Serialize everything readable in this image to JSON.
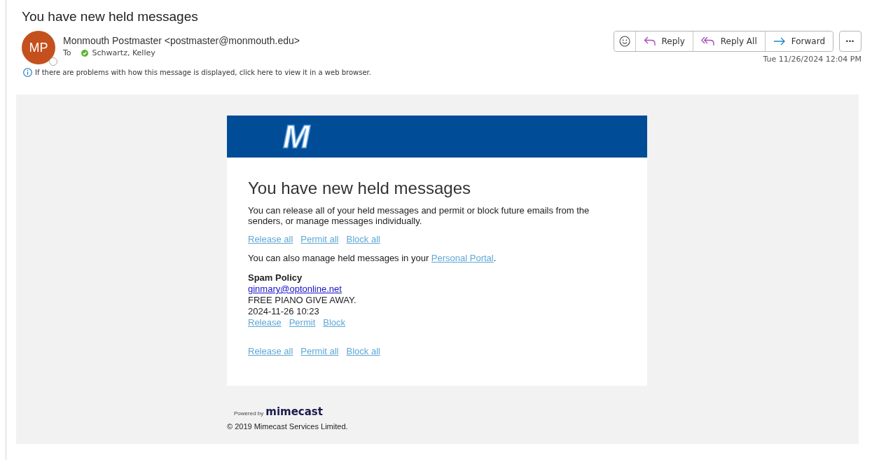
{
  "subject": "You have new held messages",
  "sender": {
    "initials": "MP",
    "name": "Monmouth Postmaster <postmaster@monmouth.edu>",
    "to_label": "To",
    "recipient": "Schwartz, Kelley"
  },
  "info_bar": "If there are problems with how this message is displayed, click here to view it in a web browser.",
  "actions": [
    {
      "kind": "emoji"
    },
    {
      "kind": "reply",
      "label": "Reply"
    },
    {
      "kind": "reply_all",
      "label": "Reply All"
    },
    {
      "kind": "forward",
      "label": "Forward"
    }
  ],
  "more_button": "•••",
  "date": "Tue 11/26/2024 12:04 PM",
  "email": {
    "logo": "M",
    "heading": "You have new held messages",
    "intro": "You can release all of your held messages and permit or block future emails from the senders, or manage messages individually.",
    "top_links": [
      "Release all",
      "Permit all",
      "Block all"
    ],
    "portal_text": "You can also manage held messages in your ",
    "portal_link": "Personal Portal",
    "portal_end": ".",
    "messages": [
      {
        "policy": "Spam Policy",
        "from": "ginmary@optonline.net",
        "subject": "FREE PIANO GIVE AWAY.",
        "time": "2024-11-26 10:23",
        "links": [
          "Release",
          "Permit",
          "Block"
        ]
      }
    ],
    "bottom_links": [
      "Release all",
      "Permit all",
      "Block all"
    ],
    "powered_by": "Powered by",
    "brand": "mimecast",
    "copyright": "© 2019 Mimecast Services Limited."
  }
}
